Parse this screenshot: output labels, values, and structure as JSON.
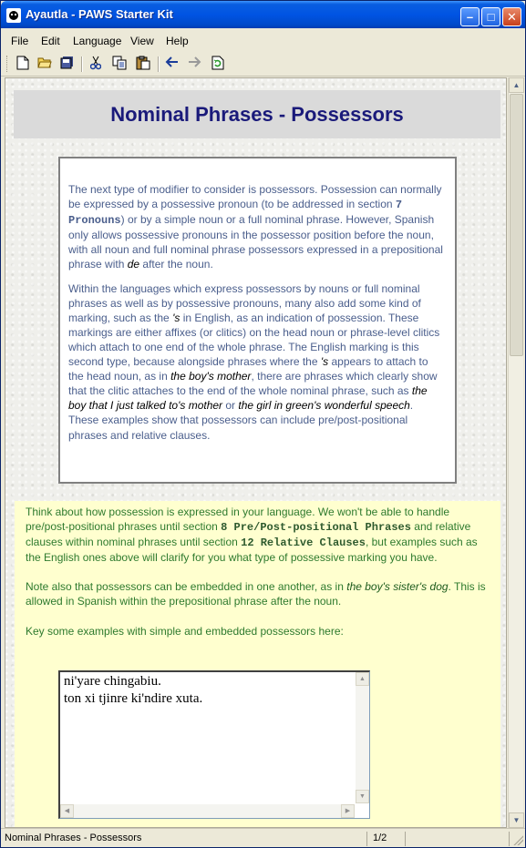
{
  "window": {
    "title": "Ayautla - PAWS Starter Kit",
    "buttons": {
      "minimize": "–",
      "maximize": "□",
      "close": "✕"
    }
  },
  "menu": [
    "File",
    "Edit",
    "Language",
    "View",
    "Help"
  ],
  "toolbar": {
    "icons": [
      "new-icon",
      "open-icon",
      "save-all-icon",
      "cut-icon",
      "copy-icon",
      "paste-icon",
      "back-icon",
      "forward-icon",
      "refresh-icon"
    ]
  },
  "page": {
    "title": "Nominal Phrases - Possessors",
    "intro": {
      "p1_a": "The next type of modifier to consider is possessors. Possession can normally be expressed by a possessive pronoun (to be addressed in section ",
      "p1_sec": "7 Pronouns",
      "p1_b": ") or by a simple noun or a full nominal phrase. However, Spanish only allows possessive pronouns in the possessor position before the noun, with all noun and full nominal phrase possessors expressed in a prepositional phrase with ",
      "p1_de": "de",
      "p1_c": " after the noun.",
      "p2_a": "Within the languages which express possessors by nouns or full nominal phrases as well as by possessive pronouns, many also add some kind of marking, such as the ",
      "p2_s1": "'s",
      "p2_b": " in English, as an indication of possession. These markings are either affixes (or clitics) on the head noun or phrase-level clitics which attach to one end of the whole phrase. The English marking is this second type, because alongside phrases where the ",
      "p2_s2": "'s",
      "p2_c": " appears to attach to the head noun, as in ",
      "p2_ex1": "the boy's mother",
      "p2_d": ", there are phrases which clearly show that the clitic attaches to the end of the whole nominal phrase, such as ",
      "p2_ex2": "the boy that I just talked to's mother",
      "p2_e": " or ",
      "p2_ex3": "the girl in green's wonderful speech",
      "p2_f": ". These examples show that possessors can include pre/post-positional phrases and relative clauses."
    },
    "task": {
      "p1_a": "Think about how possession is expressed in your language. We won't be able to handle pre/post-positional phrases until section ",
      "p1_sec1": "8 Pre/Post-positional Phrases",
      "p1_b": " and relative clauses within nominal phrases until section ",
      "p1_sec2": "12 Relative Clauses",
      "p1_c": ", but examples such as the English ones above will clarify for you what type of possessive marking you have.",
      "p2_a": "Note also that possessors can be embedded in one another, as in ",
      "p2_ex": "the boy's sister's dog",
      "p2_b": ". This is allowed in Spanish within the prepositional phrase after the noun.",
      "p3": "Key some examples with simple and embedded possessors here:"
    },
    "editor_lines": [
      "ni'yare chingabiu.",
      "ton xi tjinre ki'ndire xuta."
    ]
  },
  "status": {
    "text": "Nominal Phrases - Possessors",
    "page": "1/2"
  },
  "colors": {
    "title_bar": "#0054e3",
    "heading": "#1a1a7a",
    "intro_text": "#4a5e8c",
    "task_bg": "#ffffcf",
    "task_text": "#2e7a2e"
  }
}
